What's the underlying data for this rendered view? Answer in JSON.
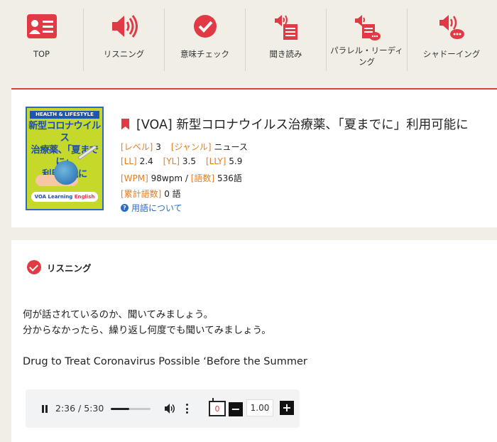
{
  "nav": [
    {
      "label": "TOP",
      "icon": "id-card-icon"
    },
    {
      "label": "リスニング",
      "icon": "speaker-icon"
    },
    {
      "label": "意味チェック",
      "icon": "check-circle-icon"
    },
    {
      "label": "聞き読み",
      "icon": "speaker-document-icon"
    },
    {
      "label": "パラレル・リーディング",
      "icon": "speaker-document-chat-icon"
    },
    {
      "label": "シャドーイング",
      "icon": "speaker-chat-icon"
    }
  ],
  "article": {
    "cover": {
      "band": "HEALTH & LIFESTYLE",
      "title_line1": "新型コロナウイルス",
      "title_line2": "治療薬、「夏までに」",
      "title_line3": "利用可能に",
      "footer_prefix": "VOA Learning ",
      "footer_accent": "English"
    },
    "title": "[VOA] 新型コロナウイルス治療薬、「夏までに」利用可能に",
    "level_key": "[レベル]",
    "level_val": "3",
    "genre_key": "[ジャンル]",
    "genre_val": "ニュース",
    "ll_key": "[LL]",
    "ll_val": "2.4",
    "yl_key": "[YL]",
    "yl_val": "3.5",
    "lly_key": "[LLY]",
    "lly_val": "5.9",
    "wpm_key": "[WPM]",
    "wpm_val": "98wpm",
    "slash": "/",
    "words_key": "[語数]",
    "words_val": "536語",
    "total_key": "[累計語数]",
    "total_val": "0 語",
    "help": "用語について"
  },
  "listening": {
    "heading": "リスニング",
    "instruction_line1": "何が話されているのか、聞いてみましょう。",
    "instruction_line2": "分からなかったら、繰り返し何度でも聞いてみましょう。",
    "english_title": "Drug to Treat Coronavirus Possible ‘Before the Summer"
  },
  "player": {
    "time": "2:36 / 5:30",
    "progress": 0.47,
    "loop_count": "0",
    "rate": "1.00",
    "minus": "−",
    "plus": "+"
  },
  "colors": {
    "accent": "#e23a44",
    "key": "#e67e22",
    "link": "#2a6abf",
    "background": "#f1eee6"
  }
}
